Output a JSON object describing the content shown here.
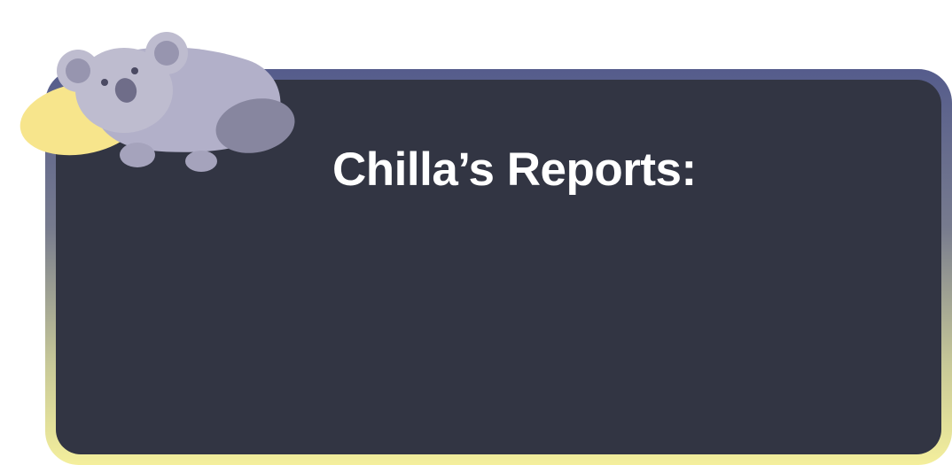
{
  "panel": {
    "title": "Chilla’s Reports:"
  },
  "mascot": {
    "icon": "koala-mascot-icon"
  },
  "colors": {
    "panel_background": "#323543",
    "frame_top": "#555c8c",
    "frame_bottom": "#f4ef9c",
    "title_text": "#ffffff",
    "koala_body": "#b2b0c9",
    "koala_shadow": "#87869f",
    "moon": "#f7e58c"
  }
}
